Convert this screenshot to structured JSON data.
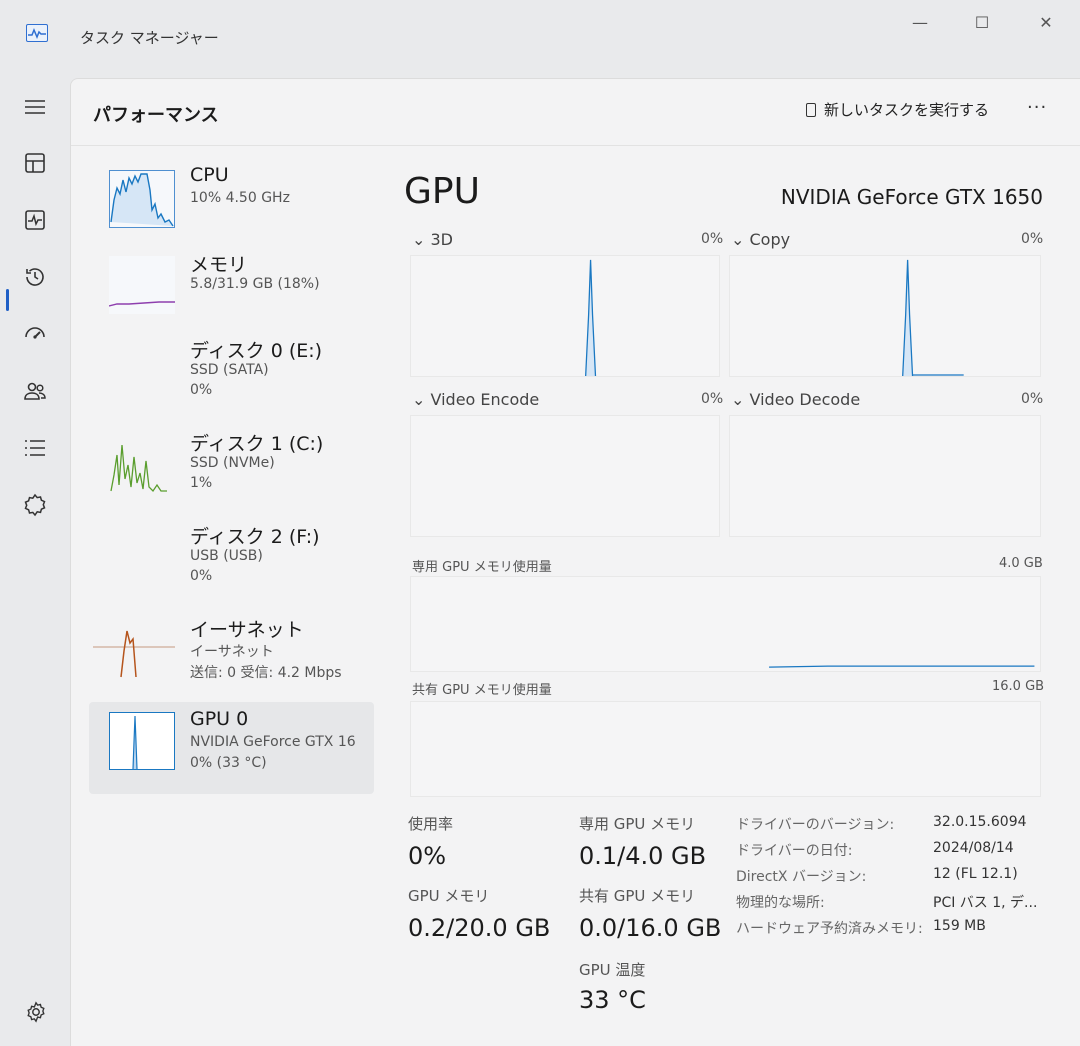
{
  "window": {
    "title": "タスク マネージャー",
    "controls": {
      "minimize": "—",
      "maximize": "☐",
      "close": "✕"
    }
  },
  "nav": {
    "items": [
      {
        "icon": "hamburger-menu-icon"
      },
      {
        "icon": "processes-icon"
      },
      {
        "icon": "performance-icon",
        "active": true
      },
      {
        "icon": "app-history-icon"
      },
      {
        "icon": "startup-apps-icon"
      },
      {
        "icon": "users-icon"
      },
      {
        "icon": "details-icon"
      },
      {
        "icon": "services-icon"
      }
    ],
    "settings_icon": "settings-icon"
  },
  "header": {
    "title": "パフォーマンス",
    "new_task_label": "新しいタスクを実行する",
    "more_label": "···"
  },
  "devices": [
    {
      "name": "CPU",
      "sub1": "10%  4.50 GHz",
      "sub2": "",
      "color": "#1a78c2"
    },
    {
      "name": "メモリ",
      "sub1": "5.8/31.9 GB (18%)",
      "sub2": "",
      "color": "#8e3fae"
    },
    {
      "name": "ディスク 0 (E:)",
      "sub1": "SSD (SATA)",
      "sub2": "0%",
      "color": "#5a9e2e"
    },
    {
      "name": "ディスク 1 (C:)",
      "sub1": "SSD (NVMe)",
      "sub2": "1%",
      "color": "#5a9e2e"
    },
    {
      "name": "ディスク 2 (F:)",
      "sub1": "USB (USB)",
      "sub2": "0%",
      "color": "#5a9e2e"
    },
    {
      "name": "イーサネット",
      "sub1": "イーサネット",
      "sub2": "送信: 0 受信: 4.2 Mbps",
      "color": "#b5541c"
    },
    {
      "name": "GPU 0",
      "sub1": "NVIDIA GeForce GTX 16",
      "sub2": "0% (33 °C)",
      "color": "#1a78c2",
      "selected": true
    }
  ],
  "gpu": {
    "title": "GPU",
    "model": "NVIDIA GeForce GTX 1650",
    "engines": [
      {
        "label": "3D",
        "value": "0%"
      },
      {
        "label": "Copy",
        "value": "0%"
      },
      {
        "label": "Video Encode",
        "value": "0%"
      },
      {
        "label": "Video Decode",
        "value": "0%"
      }
    ],
    "engine_chevron": "⌄",
    "dedicated_mem_label": "専用 GPU メモリ使用量",
    "dedicated_mem_max": "4.0 GB",
    "shared_mem_label": "共有 GPU メモリ使用量",
    "shared_mem_max": "16.0 GB",
    "graph_color": "#1a78c2"
  },
  "stats": {
    "usage_label": "使用率",
    "usage_value": "0%",
    "dedicated_label": "専用 GPU メモリ",
    "dedicated_value": "0.1/4.0 GB",
    "gpu_mem_label": "GPU メモリ",
    "gpu_mem_value": "0.2/20.0 GB",
    "shared_label": "共有 GPU メモリ",
    "shared_value": "0.0/16.0 GB",
    "temp_label": "GPU 温度",
    "temp_value": "33 °C"
  },
  "info": [
    {
      "key": "ドライバーのバージョン:",
      "value": "32.0.15.6094"
    },
    {
      "key": "ドライバーの日付:",
      "value": "2024/08/14"
    },
    {
      "key": "DirectX バージョン:",
      "value": "12 (FL 12.1)"
    },
    {
      "key": "物理的な場所:",
      "value": "PCI バス 1, デ..."
    },
    {
      "key": "ハードウェア予約済みメモリ:",
      "value": "159 MB"
    }
  ]
}
